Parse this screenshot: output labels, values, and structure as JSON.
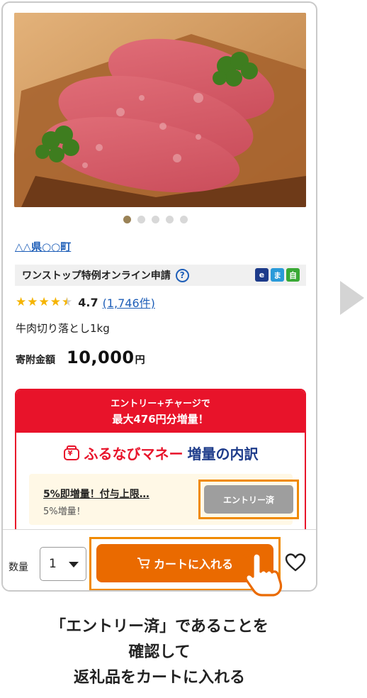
{
  "product": {
    "municipality": "△△県○○町",
    "onestop_label": "ワンストップ特例オンライン申請",
    "help_icon": "?",
    "badges": [
      "e",
      "ま",
      "自"
    ],
    "rating": {
      "score": 4.7,
      "stars": 4.7,
      "score_text": "4.7",
      "reviews_text": "(1,746件)"
    },
    "name": "牛肉切り落とし1kg",
    "donation_label": "寄附金額",
    "donation_amount": "10,000",
    "donation_unit": "円",
    "image_slides": 5,
    "active_slide": 1
  },
  "promo": {
    "line1": "エントリー+チャージで",
    "line2": "最大476円分増量！",
    "brand": "ふるなびマネー",
    "title_rest": "増量の内訳",
    "entry_title": "5%即増量！付与上限…",
    "entry_sub": "5%増量！",
    "entry_button": "エントリー済"
  },
  "purchase": {
    "qty_label": "数量",
    "qty_value": "1",
    "cart_button": "カートに入れる"
  },
  "caption": {
    "line1": "「エントリー済」であることを",
    "line2": "確認して",
    "line3": "返礼品をカートに入れる"
  },
  "colors": {
    "accent_red": "#e8132a",
    "cart_orange": "#ea6a00",
    "highlight_orange": "#f08a00",
    "link_blue": "#1f5fb8"
  },
  "icons": [
    "help-icon",
    "cart-icon",
    "heart-icon",
    "wallet-icon",
    "tap-hand-icon",
    "next-arrow-icon"
  ]
}
